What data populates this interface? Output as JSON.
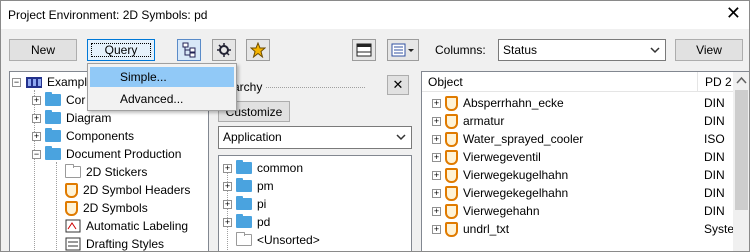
{
  "window": {
    "title": "Project Environment: 2D Symbols: pd",
    "close_glyph": "✕"
  },
  "toolbar": {
    "new_label": "New",
    "query_label": "Query",
    "columns_label": "Columns:",
    "columns_value": "Status",
    "view_label": "View"
  },
  "query_menu": {
    "items": [
      {
        "label": "Simple..."
      },
      {
        "label": "Advanced..."
      }
    ]
  },
  "left_tree": {
    "items": [
      {
        "label": "Exampl"
      },
      {
        "label": "Cor"
      },
      {
        "label": "Diagram"
      },
      {
        "label": "Components"
      },
      {
        "label": "Document Production"
      },
      {
        "label": "2D Stickers"
      },
      {
        "label": "2D Symbol Headers"
      },
      {
        "label": "2D Symbols"
      },
      {
        "label": "Automatic Labeling"
      },
      {
        "label": "Drafting Styles"
      }
    ]
  },
  "hierarchy": {
    "header_label": "rarchy",
    "close_glyph": "✕",
    "customize_label": "Customize",
    "dropdown_value": "Application",
    "items": [
      {
        "label": "common"
      },
      {
        "label": "pm"
      },
      {
        "label": "pi"
      },
      {
        "label": "pd"
      },
      {
        "label": "<Unsorted>"
      }
    ]
  },
  "object_list": {
    "col_object": "Object",
    "col_pd": "PD 2",
    "rows": [
      {
        "name": "Absperrhahn_ecke",
        "pd": "DIN"
      },
      {
        "name": "armatur",
        "pd": "DIN"
      },
      {
        "name": "Water_sprayed_cooler",
        "pd": "ISO"
      },
      {
        "name": "Vierwegeventil",
        "pd": "DIN"
      },
      {
        "name": "Vierwegekugelhahn",
        "pd": "DIN"
      },
      {
        "name": "Vierwegekegelhahn",
        "pd": "DIN"
      },
      {
        "name": "Vierwegehahn",
        "pd": "DIN"
      },
      {
        "name": "undrl_txt",
        "pd": "Syste"
      }
    ]
  }
}
